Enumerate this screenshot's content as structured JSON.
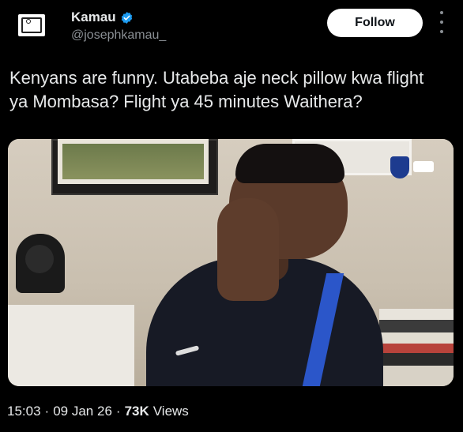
{
  "author": {
    "display_name": "Kamau",
    "handle": "@josephkamau_",
    "verified": true
  },
  "actions": {
    "follow_label": "Follow"
  },
  "tweet": {
    "text_line1": "Kenyans are funny. Utabeba aje neck pillow kwa flight",
    "text_line2": "ya Mombasa?  Flight ya 45 minutes Waithera?"
  },
  "meta": {
    "time": "15:03",
    "sep1": "·",
    "date": "09 Jan 26",
    "sep2": "·",
    "views_count": "73K",
    "views_label": "Views"
  },
  "colors": {
    "background": "#000000",
    "text": "#e7e9ea",
    "muted": "#8a8f94",
    "verified": "#1d9bf0"
  }
}
